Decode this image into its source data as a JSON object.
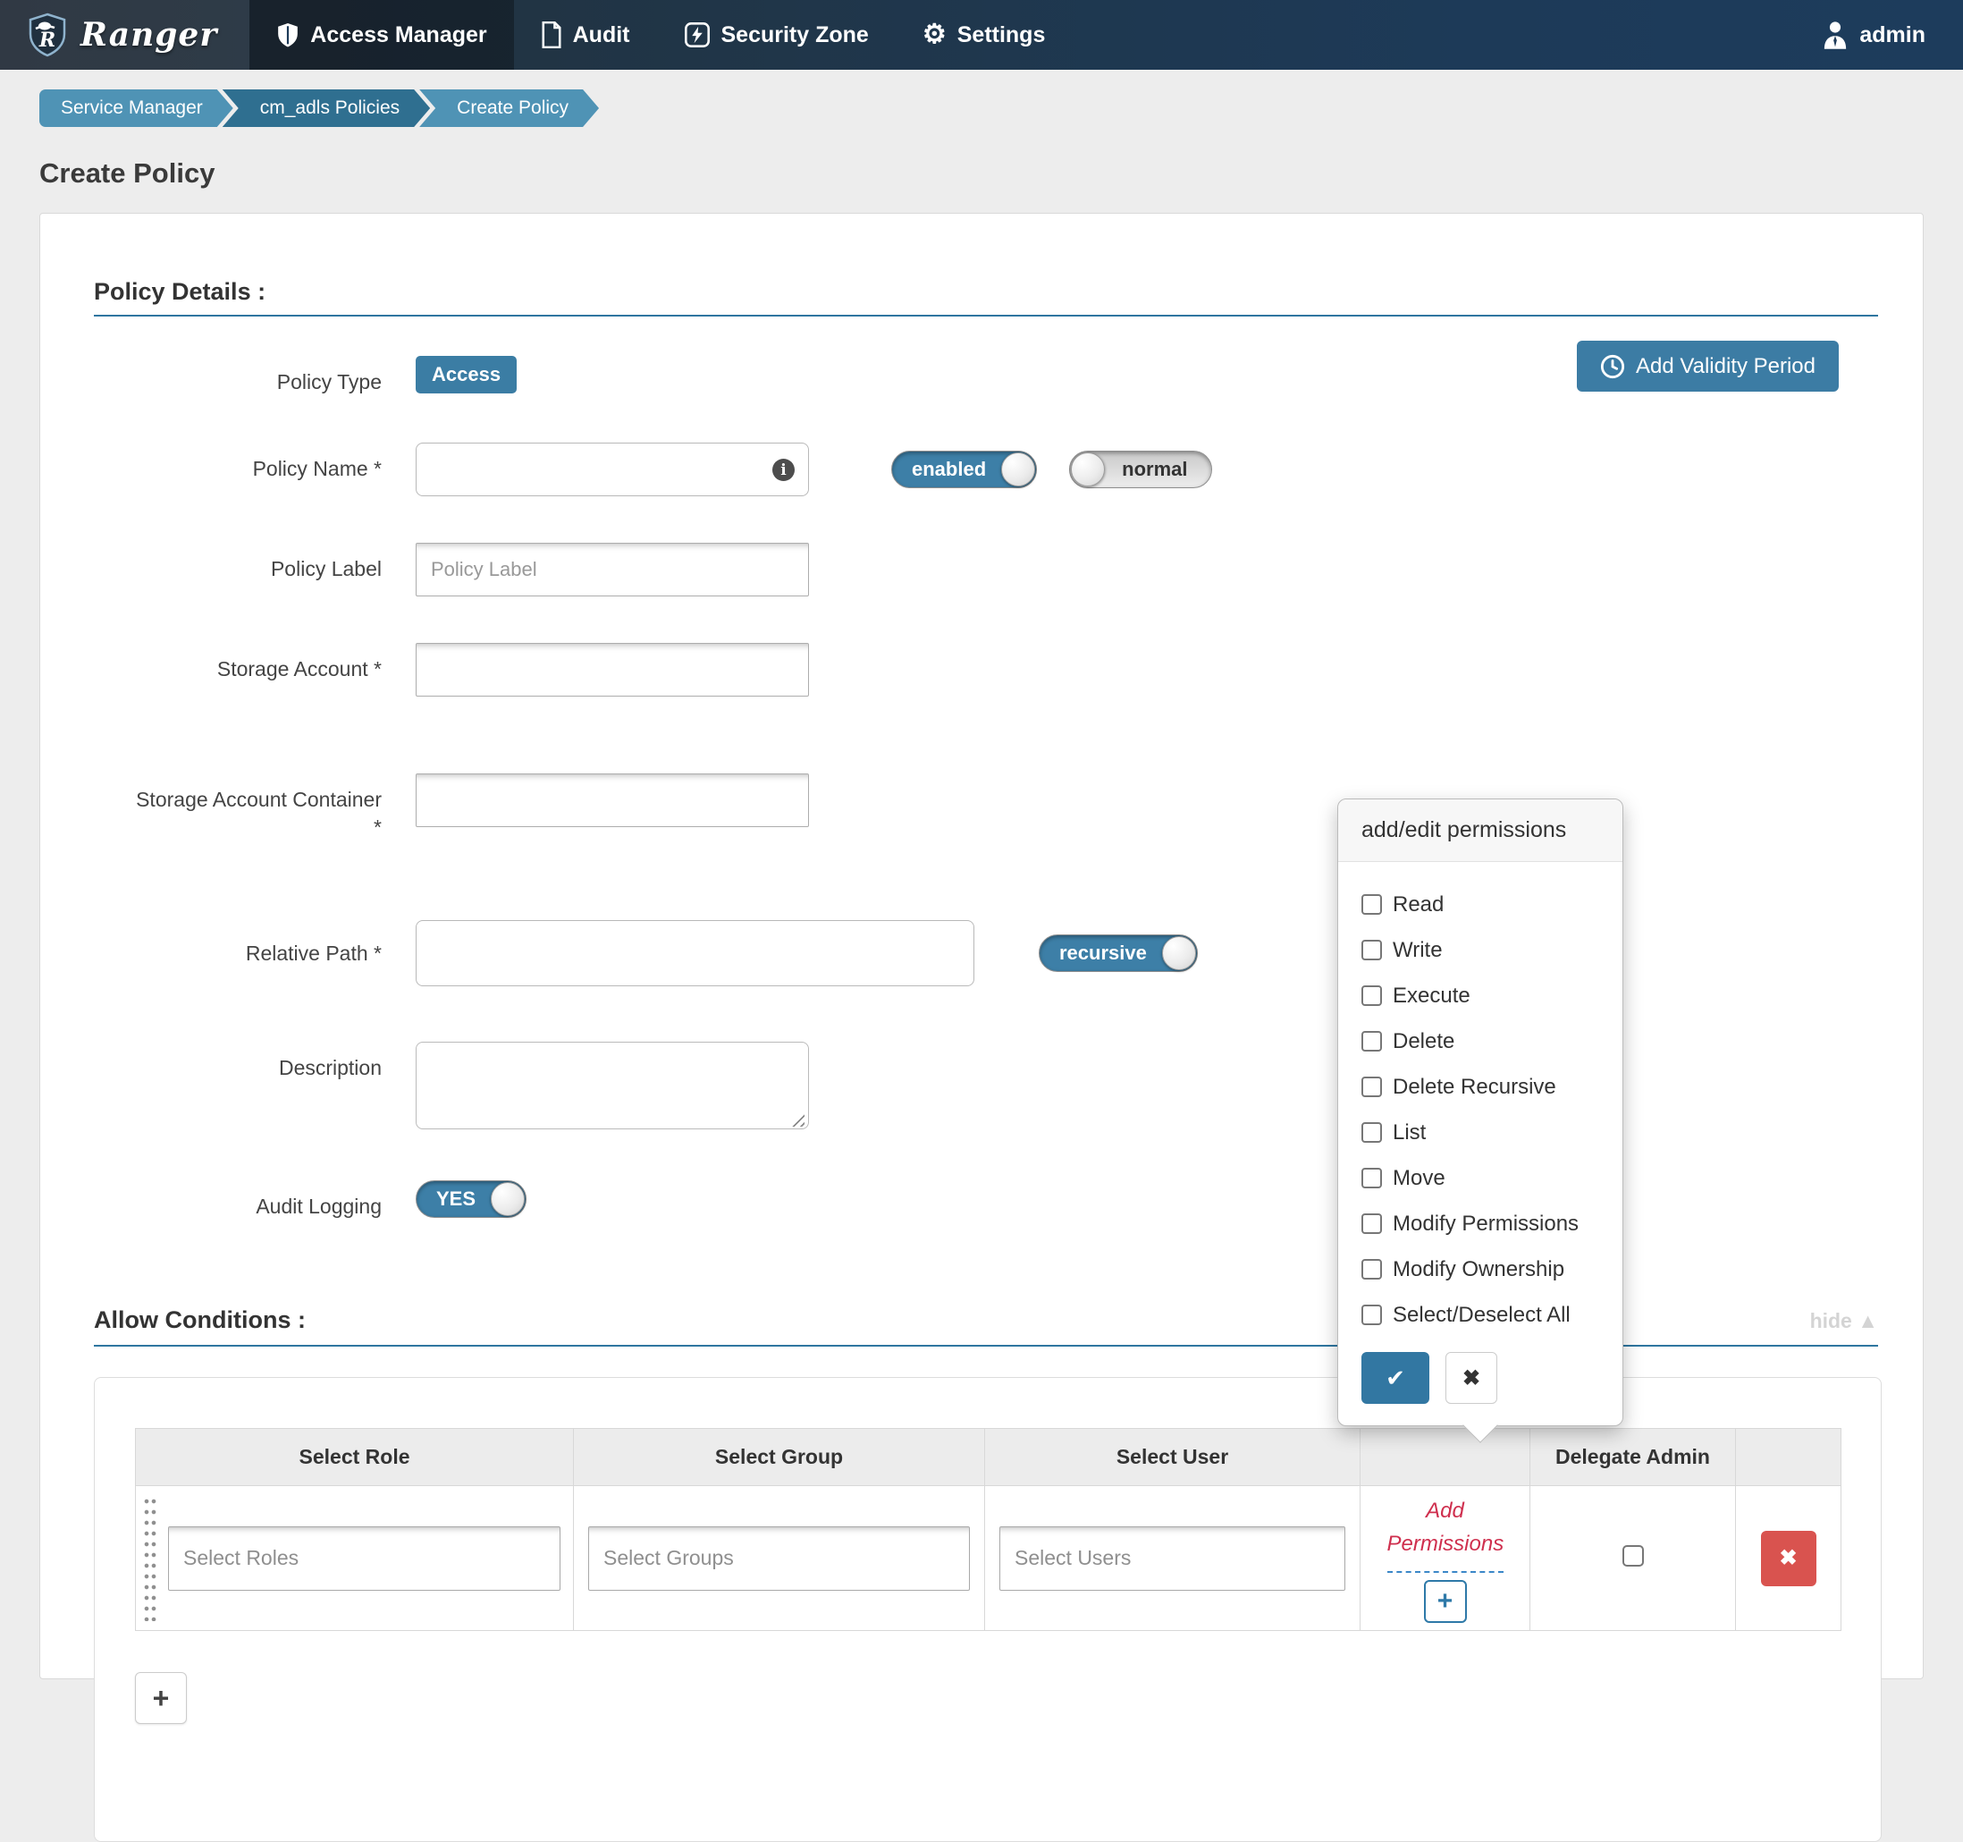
{
  "navbar": {
    "brand": "Ranger",
    "items": [
      {
        "label": "Access Manager",
        "icon": "shield-icon",
        "active": true
      },
      {
        "label": "Audit",
        "icon": "document-icon",
        "active": false
      },
      {
        "label": "Security Zone",
        "icon": "lightning-icon",
        "active": false
      },
      {
        "label": "Settings",
        "icon": "gear-icon",
        "active": false
      }
    ],
    "gear_glyph": "⚙",
    "user_label": "admin",
    "user_icon": "user-icon"
  },
  "breadcrumb": {
    "items": [
      {
        "label": "Service Manager"
      },
      {
        "label": "cm_adls Policies"
      },
      {
        "label": "Create Policy"
      }
    ]
  },
  "page": {
    "title": "Create Policy"
  },
  "policy_details": {
    "heading": "Policy Details :",
    "add_validity_button": "Add Validity Period",
    "fields": {
      "policy_type": {
        "label": "Policy Type",
        "value": "Access"
      },
      "policy_name": {
        "label": "Policy Name *",
        "value": ""
      },
      "policy_label": {
        "label": "Policy Label",
        "placeholder": "Policy Label",
        "value": ""
      },
      "storage_account": {
        "label": "Storage Account *",
        "value": ""
      },
      "storage_account_container": {
        "label": "Storage Account Container",
        "required_mark": "*",
        "value": ""
      },
      "relative_path": {
        "label": "Relative Path *",
        "value": ""
      },
      "description": {
        "label": "Description",
        "value": ""
      },
      "audit_logging": {
        "label": "Audit Logging"
      }
    },
    "toggles": {
      "enabled": "enabled",
      "normal": "normal",
      "recursive": "recursive",
      "audit": "YES"
    }
  },
  "allow_conditions": {
    "heading": "Allow Conditions :",
    "hide_label": "hide",
    "hide_arrow": "▲",
    "headers": {
      "role": "Select Role",
      "group": "Select Group",
      "user": "Select User",
      "delegate": "Delegate Admin"
    },
    "row": {
      "roles_placeholder": "Select Roles",
      "groups_placeholder": "Select Groups",
      "users_placeholder": "Select Users",
      "permissions_label": "Add Permissions",
      "add_permission_symbol": "+",
      "delete_symbol": "✖"
    },
    "add_row_symbol": "+"
  },
  "permissions_popup": {
    "title": "add/edit permissions",
    "options": [
      "Read",
      "Write",
      "Execute",
      "Delete",
      "Delete Recursive",
      "List",
      "Move",
      "Modify Permissions",
      "Modify Ownership",
      "Select/Deselect All"
    ],
    "confirm_symbol": "✔",
    "cancel_symbol": "✖"
  },
  "colors": {
    "accent": "#3c7ca4",
    "danger": "#d9534f",
    "permissions_red": "#cf2f4e",
    "breadcrumb_light": "#4f93b5",
    "breadcrumb_dark": "#2f6f90",
    "navbar_left": "#252f3a",
    "navbar_right": "#1d3c5c",
    "section_rule": "#2f76a0"
  }
}
